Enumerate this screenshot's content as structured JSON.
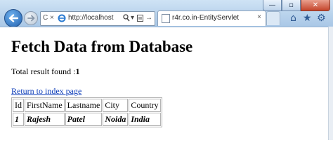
{
  "browser": {
    "address_url": "http://localhost",
    "tab_title": "r4r.co.in-EntityServlet",
    "tab_close": "×",
    "window_min": "—",
    "window_max": "▫",
    "window_close": "✕"
  },
  "page": {
    "heading": "Fetch Data from Database",
    "total_label": "Total result found :",
    "total_count": "1",
    "return_link": "Return to index page"
  },
  "table": {
    "headers": [
      "Id",
      "FirstName",
      "Lastname",
      "City",
      "Country"
    ],
    "rows": [
      [
        "1",
        "Rajesh",
        "Patel",
        "Noida",
        "India"
      ]
    ]
  }
}
